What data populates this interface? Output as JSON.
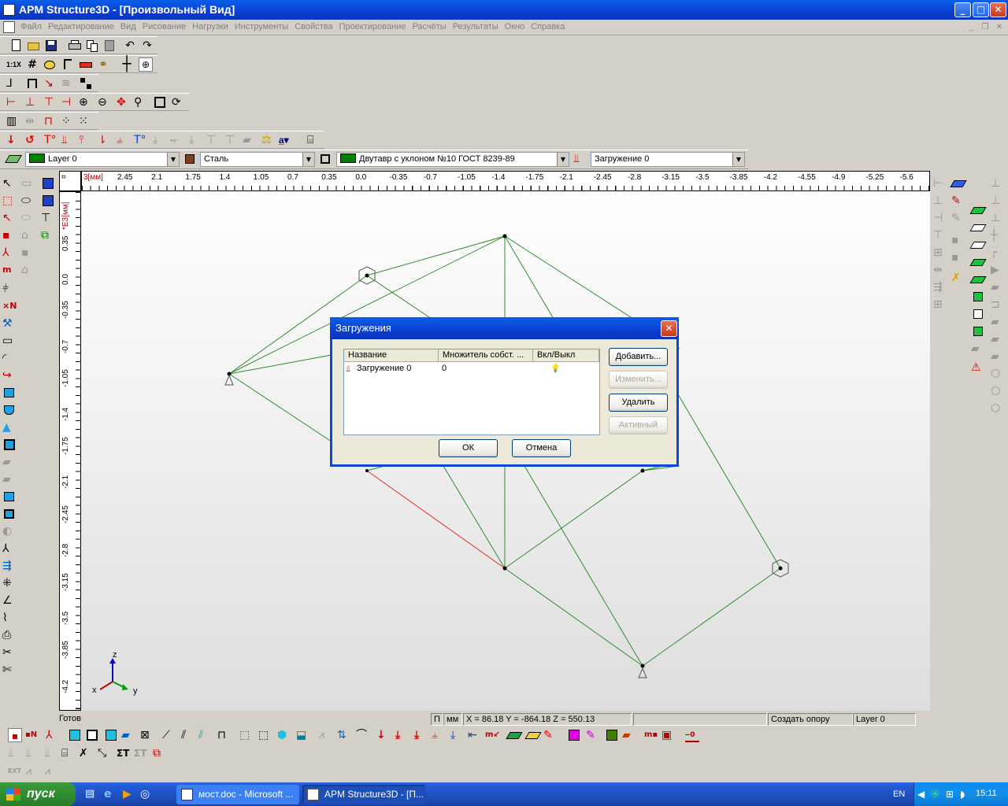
{
  "window": {
    "title": "APM Structure3D - [Произвольный Вид]"
  },
  "menu": [
    "Файл",
    "Редактирование",
    "Вид",
    "Рисование",
    "Нагрузки",
    "Инструменты",
    "Свойства",
    "Проектирование",
    "Расчёты",
    "Результаты",
    "Окно",
    "Справка"
  ],
  "toolbar": {
    "small_label": "1:1X"
  },
  "props": {
    "layer": "Layer 0",
    "layer_color": "#008000",
    "material": "Сталь",
    "section": "Двутавр с уклоном  №10 ГОСТ 8239-89",
    "section_color": "#008000",
    "load": "Загружение 0"
  },
  "ruler": {
    "h_unit": "3[мм]",
    "h_ticks": [
      "2.45",
      "2.1",
      "1.75",
      "1.4",
      "1.05",
      "0.7",
      "0.35",
      "0.0",
      "-0.35",
      "-0.7",
      "-1.05",
      "-1.4",
      "-1.75",
      "-2.1",
      "-2.45",
      "-2.8",
      "-3.15",
      "-3.5",
      "-3.85",
      "-4.2",
      "-4.55",
      "-4.9",
      "-5.25",
      "-5.6"
    ],
    "v_unit": "*E3[мм]",
    "v_ticks": [
      "0.35",
      "0.0",
      "-0.35",
      "-0.7",
      "-1.05",
      "-1.4",
      "-1.75",
      "-2.1",
      "-2.45",
      "-2.8",
      "-3.15",
      "-3.5",
      "-3.85",
      "-4.2"
    ]
  },
  "axes": {
    "z": "z",
    "x": "x",
    "y": "y"
  },
  "status": {
    "ready": "Готов",
    "p": "П",
    "mm": "мм",
    "coords": "X = 86.18 Y = -864.18 Z = 550.13",
    "hint": "Создать опору",
    "layer": "Layer 0"
  },
  "dialog": {
    "title": "Загружения",
    "close": "✕",
    "columns": [
      "Название",
      "Множитель собст. ...",
      "Вкл/Выкл"
    ],
    "rows": [
      {
        "name": "Загружение 0",
        "factor": "0",
        "on": "💡"
      }
    ],
    "buttons": {
      "add": "Добавить...",
      "edit": "Изменить...",
      "delete": "Удалить",
      "active": "Активный",
      "ok": "ОК",
      "cancel": "Отмена"
    }
  },
  "taskbar": {
    "start": "пуск",
    "tasks": [
      "мост.doc - Microsoft ...",
      "APM Structure3D - [П..."
    ],
    "lang": "EN",
    "clock": "15:11"
  }
}
